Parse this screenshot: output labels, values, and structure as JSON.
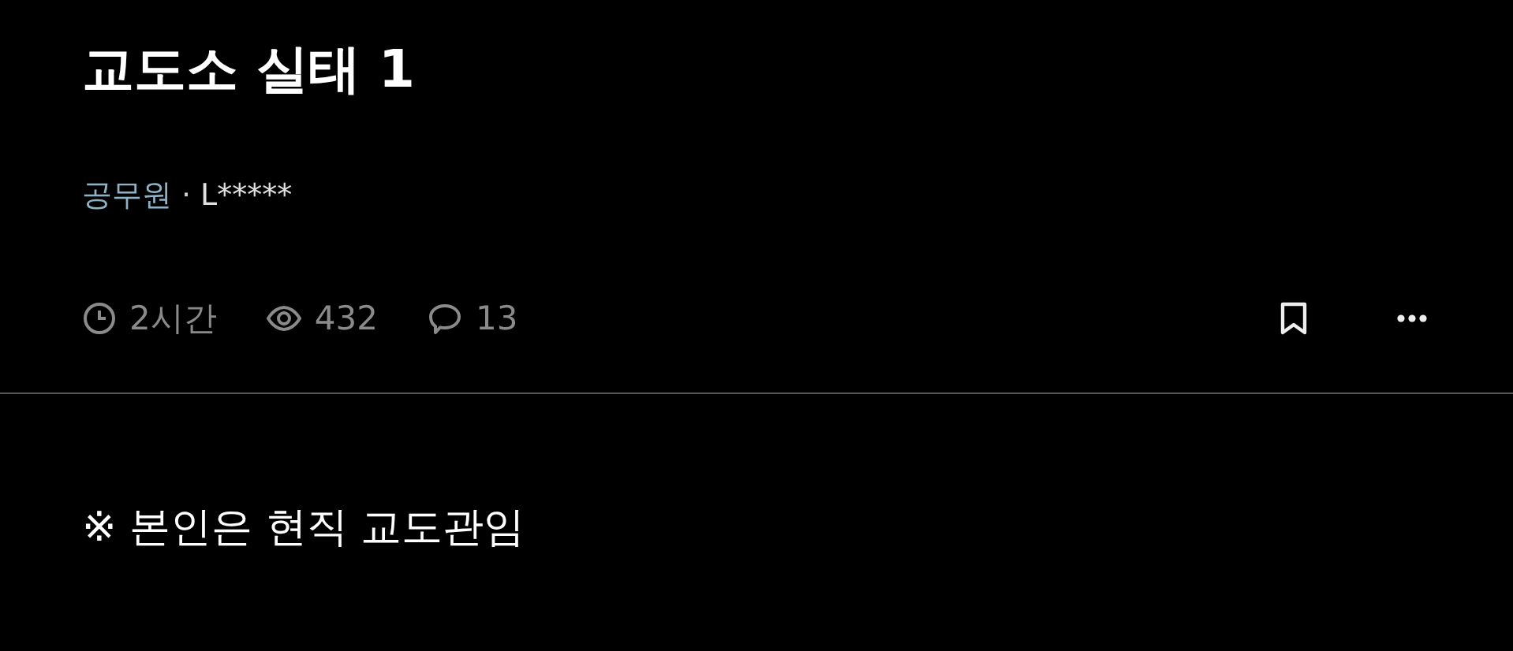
{
  "post": {
    "title": "교도소 실태 1",
    "board": "공무원",
    "separator": "·",
    "author": "L*****",
    "meta": [
      {
        "kind": "time",
        "text": "2시간"
      },
      {
        "kind": "views",
        "text": "432"
      },
      {
        "kind": "comments",
        "text": "13"
      }
    ],
    "body": "※ 본인은 현직 교도관임"
  }
}
